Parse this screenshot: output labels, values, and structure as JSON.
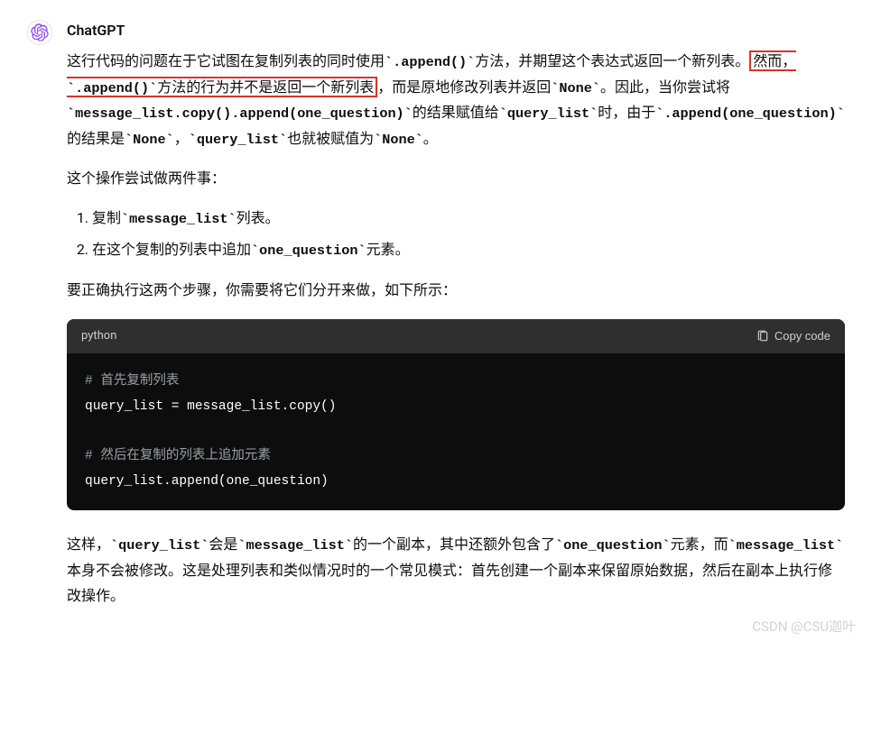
{
  "author": "ChatGPT",
  "p1": {
    "t1": "这行代码的问题在于它试图在复制列表的同时使用",
    "c1": "`.append()`",
    "t2": "方法，并期望这个表达式返回一个新列表。",
    "hl_t1": "然而，",
    "hl_c1": "`.append()`",
    "hl_t2": "方法的行为并不是返回一个新列表",
    "t3": "，而是原地修改列表并返回",
    "c2": "`None`",
    "t4": "。因此，当你尝试将",
    "c3": "`message_list.copy().append(one_question)`",
    "t5": "的结果赋值给",
    "c4": "`query_list`",
    "t6": "时，由于",
    "c5": "`.append(one_question)`",
    "t7": "的结果是",
    "c6": "`None`",
    "t8": "，",
    "c7": "`query_list`",
    "t9": "也就被赋值为",
    "c8": "`None`",
    "t10": "。"
  },
  "p2": "这个操作尝试做两件事：",
  "list": {
    "li1_t1": "复制",
    "li1_c1": "`message_list`",
    "li1_t2": "列表。",
    "li2_t1": "在这个复制的列表中追加",
    "li2_c1": "`one_question`",
    "li2_t2": "元素。"
  },
  "p3": "要正确执行这两个步骤，你需要将它们分开来做，如下所示：",
  "code": {
    "lang": "python",
    "copy_label": "Copy code",
    "comment1": "# 首先复制列表",
    "line1": "query_list = message_list.copy()",
    "comment2": "# 然后在复制的列表上追加元素",
    "line2": "query_list.append(one_question)"
  },
  "p4": {
    "t1": "这样，",
    "c1": "`query_list`",
    "t2": "会是",
    "c2": "`message_list`",
    "t3": "的一个副本，其中还额外包含了",
    "c3": "`one_question`",
    "t4": "元素，而",
    "c4": "`message_list`",
    "t5": "本身不会被修改。这是处理列表和类似情况时的一个常见模式：首先创建一个副本来保留原始数据，然后在副本上执行修改操作。"
  },
  "watermark": "CSDN @CSU迦叶"
}
